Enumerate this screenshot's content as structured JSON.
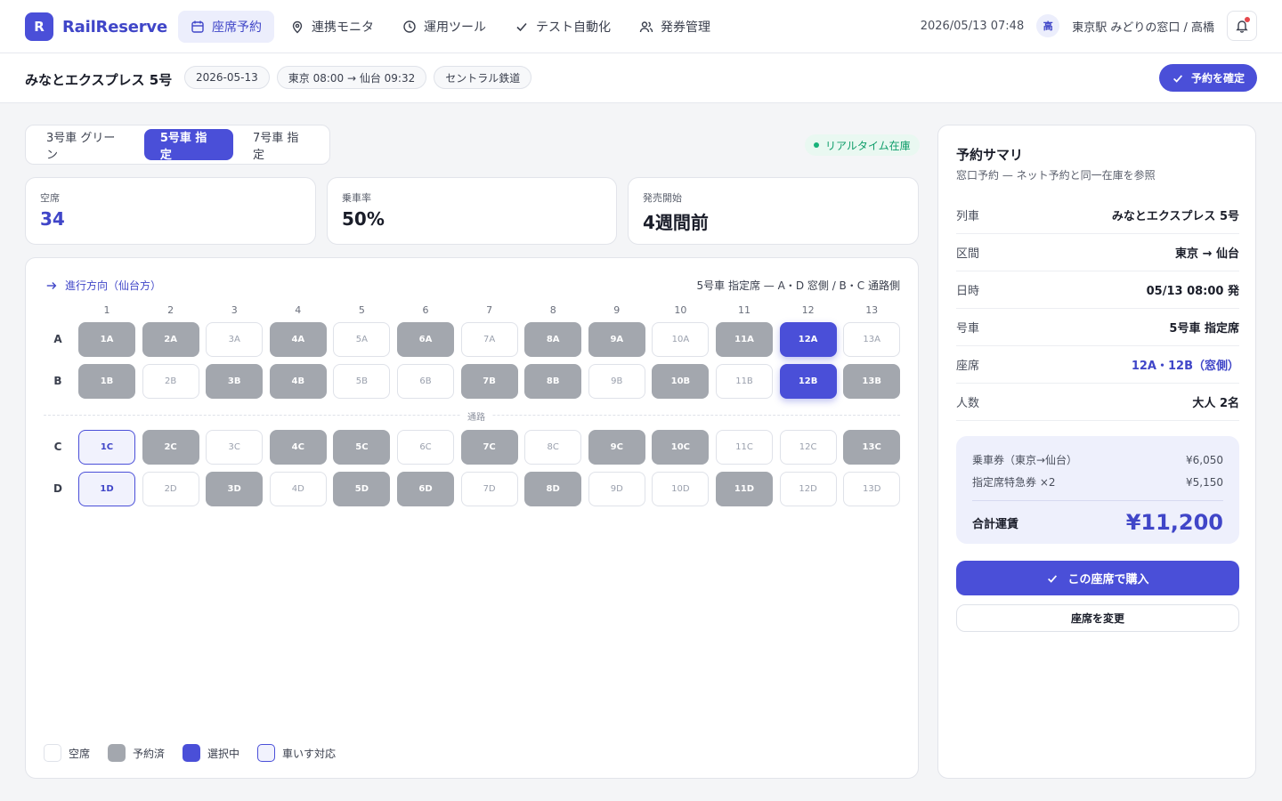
{
  "brand": {
    "logo_letter": "R",
    "name": "RailReserve"
  },
  "nav": [
    {
      "label": "座席予約",
      "icon": "calendar-icon",
      "active": true
    },
    {
      "label": "連携モニタ",
      "icon": "map-pin-icon",
      "active": false
    },
    {
      "label": "運用ツール",
      "icon": "clock-icon",
      "active": false
    },
    {
      "label": "テスト自動化",
      "icon": "check-icon",
      "active": false
    },
    {
      "label": "発券管理",
      "icon": "users-icon",
      "active": false
    }
  ],
  "topbar": {
    "datetime": "2026/05/13 07:48",
    "avatar": "高",
    "user": "東京駅 みどりの窓口 / 高橋"
  },
  "subbar": {
    "train_name": "みなとエクスプレス 5号",
    "chips": [
      "2026-05-13",
      "東京 08:00 → 仙台 09:32",
      "セントラル鉄道"
    ],
    "confirm_label": "予約を確定"
  },
  "car_tabs": [
    {
      "label": "3号車 グリーン",
      "active": false
    },
    {
      "label": "5号車 指定",
      "active": true
    },
    {
      "label": "7号車 指定",
      "active": false
    }
  ],
  "live_badge": "リアルタイム在庫",
  "stats": [
    {
      "label": "空席",
      "value": "34",
      "accent": true
    },
    {
      "label": "乗車率",
      "value": "50%",
      "accent": false
    },
    {
      "label": "発売開始",
      "value": "4週間前",
      "accent": false
    }
  ],
  "seatmap": {
    "direction": "進行方向（仙台方）",
    "car_desc": "5号車 指定席 — A・D 窓側 / B・C 通路側",
    "aisle_label": "通路",
    "columns": [
      "1",
      "2",
      "3",
      "4",
      "5",
      "6",
      "7",
      "8",
      "9",
      "10",
      "11",
      "12",
      "13"
    ],
    "rows": [
      {
        "label": "A",
        "seats": [
          "booked",
          "booked",
          "free",
          "booked",
          "free",
          "booked",
          "free",
          "booked",
          "booked",
          "free",
          "booked",
          "selected",
          "free"
        ]
      },
      {
        "label": "B",
        "seats": [
          "booked",
          "free",
          "booked",
          "booked",
          "free",
          "free",
          "booked",
          "booked",
          "free",
          "booked",
          "free",
          "selected",
          "booked"
        ]
      },
      {
        "label": "C",
        "seats": [
          "wheel",
          "booked",
          "free",
          "booked",
          "booked",
          "free",
          "booked",
          "free",
          "booked",
          "booked",
          "free",
          "free",
          "booked"
        ]
      },
      {
        "label": "D",
        "seats": [
          "wheel",
          "free",
          "booked",
          "free",
          "booked",
          "booked",
          "free",
          "booked",
          "free",
          "free",
          "booked",
          "free",
          "free"
        ]
      }
    ],
    "legend": [
      {
        "label": "空席",
        "kind": "free"
      },
      {
        "label": "予約済",
        "kind": "booked"
      },
      {
        "label": "選択中",
        "kind": "selected"
      },
      {
        "label": "車いす対応",
        "kind": "wheel"
      }
    ]
  },
  "summary": {
    "title": "予約サマリ",
    "subtitle": "窓口予約 — ネット予約と同一在庫を参照",
    "rows": [
      {
        "k": "列車",
        "v": "みなとエクスプレス 5号"
      },
      {
        "k": "区間",
        "v": "東京 → 仙台"
      },
      {
        "k": "日時",
        "v": "05/13 08:00 発"
      },
      {
        "k": "号車",
        "v": "5号車 指定席"
      },
      {
        "k": "座席",
        "v": "12A・12B（窓側）",
        "accent": true
      },
      {
        "k": "人数",
        "v": "大人 2名"
      }
    ],
    "fares": [
      {
        "k": "乗車券（東京→仙台）",
        "v": "¥6,050"
      },
      {
        "k": "指定席特急券 ×2",
        "v": "¥5,150"
      }
    ],
    "total_label": "合計運賃",
    "total_value": "¥11,200",
    "buy_label": "この座席で購入",
    "change_label": "座席を変更"
  },
  "colors": {
    "accent": "#4a4fd8",
    "booked": "#a3a7ae",
    "live": "#17b27a"
  }
}
